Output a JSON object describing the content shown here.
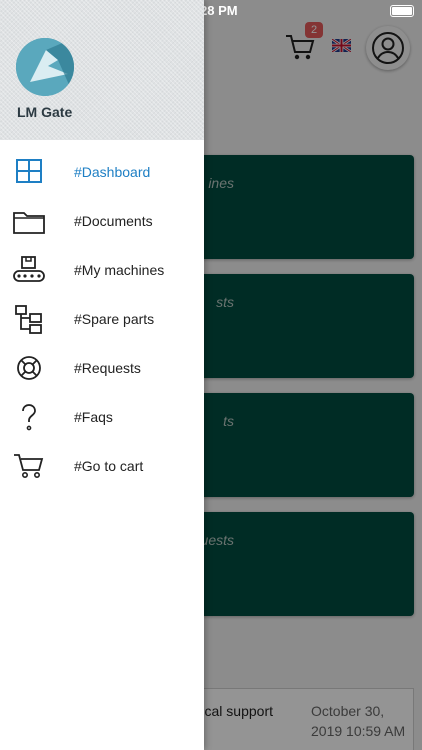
{
  "status_bar": {
    "time": "28 PM"
  },
  "header": {
    "cart_count": "2",
    "language_flag": "uk-flag-icon"
  },
  "cards": [
    {
      "label": "ines"
    },
    {
      "label": "sts"
    },
    {
      "label": "ts"
    },
    {
      "label": "uests"
    }
  ],
  "requests_table": {
    "rows": [
      {
        "subject": "cal support",
        "date": "October 30, 2019 10:59 AM"
      }
    ]
  },
  "drawer": {
    "app_name": "LM Gate",
    "menu": [
      {
        "label": "#Dashboard",
        "icon": "dashboard-icon",
        "active": true
      },
      {
        "label": "#Documents",
        "icon": "folder-icon"
      },
      {
        "label": "#My machines",
        "icon": "conveyor-icon"
      },
      {
        "label": "#Spare parts",
        "icon": "tree-icon"
      },
      {
        "label": "#Requests",
        "icon": "lifebuoy-icon"
      },
      {
        "label": "#Faqs",
        "icon": "question-icon"
      },
      {
        "label": "#Go to cart",
        "icon": "cart-icon"
      }
    ],
    "colors": {
      "active": "#1e7fc4",
      "card": "#004d40"
    }
  }
}
